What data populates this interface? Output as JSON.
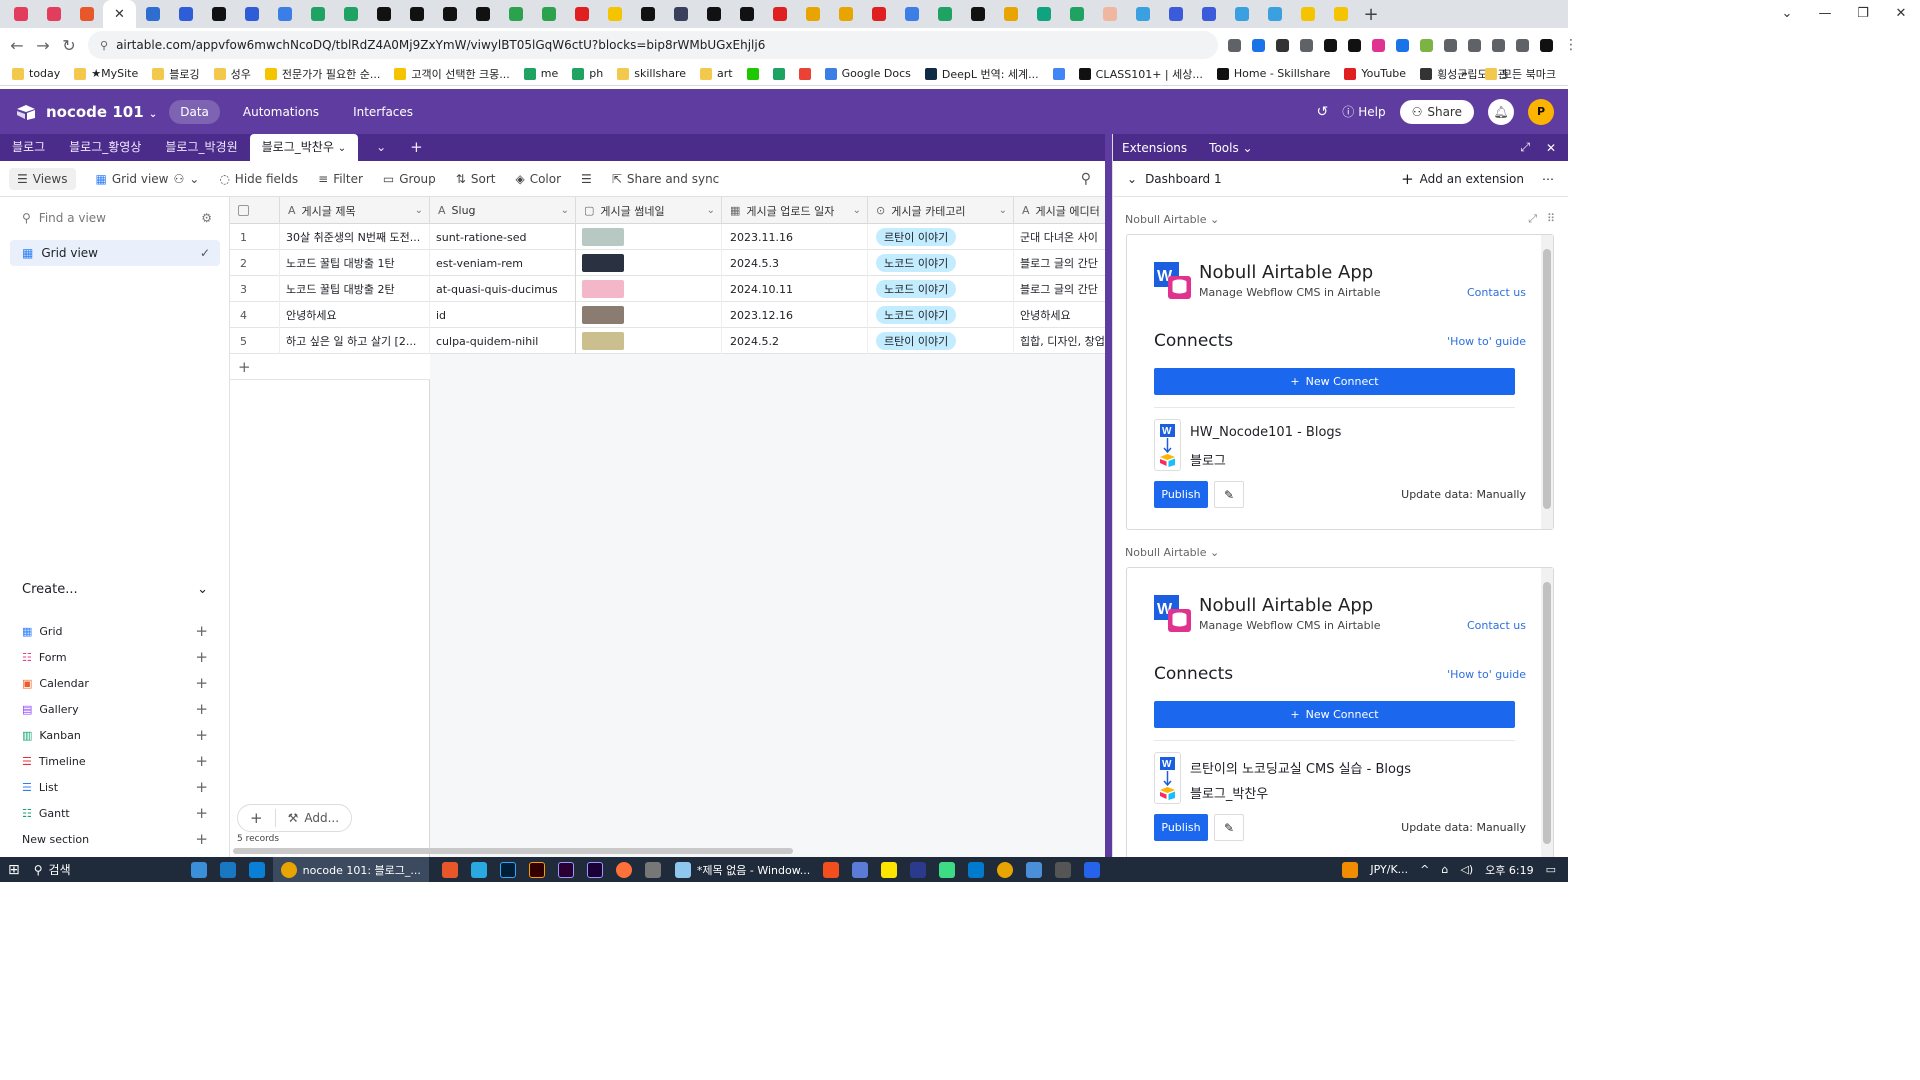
{
  "browser": {
    "url": "airtable.com/appvfow6mwchNcoDQ/tblRdZ4A0Mj9ZxYmW/viwylBT05lGqW6ctU?blocks=bip8rWMbUGxEhjlj6",
    "tab_colors": [
      "#e23d5c",
      "#e23d5c",
      "#e8572a",
      "#ffffff",
      "#2f6ed1",
      "#2f5dd8",
      "#111111",
      "#2f5dd8",
      "#3b7ee6",
      "#1ea362",
      "#1ea362",
      "#111111",
      "#111111",
      "#111111",
      "#111111",
      "#2ba24c",
      "#2ba24c",
      "#e02020",
      "#f5c400",
      "#111111",
      "#3a3f5c",
      "#111111",
      "#111111",
      "#e02020",
      "#e8a400",
      "#e8a400",
      "#e02020",
      "#3b7ee6",
      "#1ea362",
      "#111111",
      "#e8a400",
      "#10a37f",
      "#1ea362",
      "#f0b7a0",
      "#3ba0e0",
      "#3b5bdb",
      "#3b5bdb",
      "#3ba0e0",
      "#3ba0e0",
      "#f5c400",
      "#f5c400"
    ],
    "bookmarks": [
      {
        "label": "today",
        "color": "#f2c94c"
      },
      {
        "label": "★MySite",
        "color": "#f2c94c"
      },
      {
        "label": "블로깅",
        "color": "#f2c94c"
      },
      {
        "label": "성우",
        "color": "#f2c94c"
      },
      {
        "label": "전문가가 필요한 순...",
        "color": "#f5c400"
      },
      {
        "label": "고객이 선택한 크몽...",
        "color": "#f5c400"
      },
      {
        "label": "me",
        "color": "#1ea362"
      },
      {
        "label": "ph",
        "color": "#1ea362"
      },
      {
        "label": "skillshare",
        "color": "#f2c94c"
      },
      {
        "label": "art",
        "color": "#f2c94c"
      },
      {
        "label": "",
        "color": "#1ec800"
      },
      {
        "label": "",
        "color": "#1ea362"
      },
      {
        "label": "",
        "color": "#ea4335"
      },
      {
        "label": "Google Docs",
        "color": "#3b7ee6"
      },
      {
        "label": "DeepL 번역: 세계...",
        "color": "#0f2b46"
      },
      {
        "label": "",
        "color": "#4285f4"
      },
      {
        "label": "CLASS101+ | 세상...",
        "color": "#111111"
      },
      {
        "label": "Home - Skillshare",
        "color": "#111111"
      },
      {
        "label": "YouTube",
        "color": "#e02020"
      },
      {
        "label": "횡성군립도서관",
        "color": "#333333"
      }
    ],
    "bookmarks_more": "»",
    "other_bookmarks": "모든 북마크"
  },
  "app": {
    "base_name": "nocode 101",
    "nav": [
      "Data",
      "Automations",
      "Interfaces"
    ],
    "help": "Help",
    "share": "Share",
    "avatar": "P"
  },
  "table_tabs": [
    "블로그",
    "블로그_황영상",
    "블로그_박경원",
    "블로그_박찬우"
  ],
  "view_toolbar": {
    "views": "Views",
    "grid_view": "Grid view",
    "hide_fields": "Hide fields",
    "filter": "Filter",
    "group": "Group",
    "sort": "Sort",
    "color": "Color",
    "share_sync": "Share and sync"
  },
  "sidebar": {
    "find_placeholder": "Find a view",
    "active_view": "Grid view",
    "create_label": "Create...",
    "create_items": [
      {
        "label": "Grid",
        "color": "#2d7ff9"
      },
      {
        "label": "Form",
        "color": "#e73d8b"
      },
      {
        "label": "Calendar",
        "color": "#f05d23"
      },
      {
        "label": "Gallery",
        "color": "#8b46ff"
      },
      {
        "label": "Kanban",
        "color": "#11a36d"
      },
      {
        "label": "Timeline",
        "color": "#e0323c"
      },
      {
        "label": "List",
        "color": "#2d7ff9"
      },
      {
        "label": "Gantt",
        "color": "#11a36d"
      }
    ],
    "new_section": "New section"
  },
  "grid": {
    "columns": [
      "게시글 제목",
      "Slug",
      "게시글 썸네일",
      "게시글 업로드 일자",
      "게시글 카테고리",
      "게시글 에디터"
    ],
    "rows": [
      {
        "num": "1",
        "title": "30살 취준생의 N번째 도전...",
        "slug": "sunt-ratione-sed",
        "thumb": "#b8c9c4",
        "date": "2023.11.16",
        "category": "르탄이 이야기",
        "editor": "군대 다녀온 사이"
      },
      {
        "num": "2",
        "title": "노코드 꿀팁 대방출 1탄",
        "slug": "est-veniam-rem",
        "thumb": "#2a3140",
        "date": "2024.5.3",
        "category": "노코드 이야기",
        "editor": "블로그 글의 간단"
      },
      {
        "num": "3",
        "title": "노코드 꿀팁 대방출 2탄",
        "slug": "at-quasi-quis-ducimus",
        "thumb": "#f3b7c9",
        "date": "2024.10.11",
        "category": "노코드 이야기",
        "editor": "블로그 글의 간단"
      },
      {
        "num": "4",
        "title": "안녕하세요",
        "slug": "id",
        "thumb": "#8a7c70",
        "date": "2023.12.16",
        "category": "노코드 이야기",
        "editor": "안녕하세요"
      },
      {
        "num": "5",
        "title": "하고 싶은 일 하고 살기 [2...",
        "slug": "culpa-quidem-nihil",
        "thumb": "#cbbf8f",
        "date": "2024.5.2",
        "category": "르탄이 이야기",
        "editor": "힙합, 디자인, 창업"
      }
    ],
    "add_label": "Add...",
    "records": "5 records"
  },
  "extensions": {
    "tab_extensions": "Extensions",
    "tab_tools": "Tools",
    "dashboard": "Dashboard 1",
    "add_extension": "Add an extension",
    "blocks": [
      {
        "source": "Nobull Airtable",
        "app_name": "Nobull Airtable App",
        "app_sub": "Manage Webflow CMS in Airtable",
        "contact": "Contact us",
        "connects": "Connects",
        "howto": "'How to' guide",
        "new_connect": "New Connect",
        "conn_name": "HW_Nocode101 - Blogs",
        "conn_table": "블로그",
        "publish": "Publish",
        "update": "Update data: Manually"
      },
      {
        "source": "Nobull Airtable",
        "app_name": "Nobull Airtable App",
        "app_sub": "Manage Webflow CMS in Airtable",
        "contact": "Contact us",
        "connects": "Connects",
        "howto": "'How to' guide",
        "new_connect": "New Connect",
        "conn_name": "르탄이의 노코딩교실 CMS 실습 - Blogs",
        "conn_table": "블로그_박찬우",
        "publish": "Publish",
        "update": "Update data: Manually"
      }
    ]
  },
  "taskbar": {
    "search": "검색",
    "chrome_title": "nocode 101: 블로그_...",
    "notepad_title": "*제목 없음 - Window...",
    "ime": "JPY/K...",
    "time": "오후 6:19"
  }
}
